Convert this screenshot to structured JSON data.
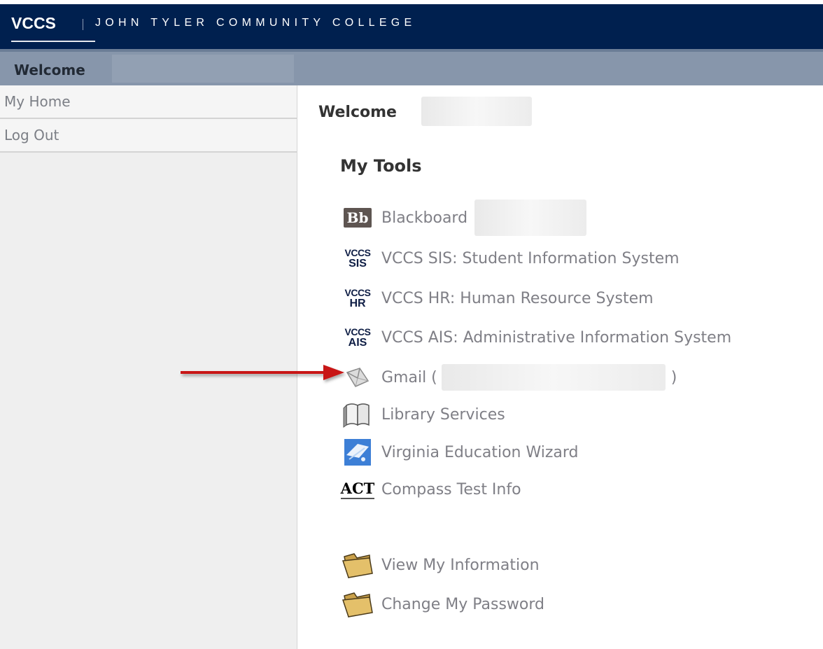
{
  "header": {
    "brand": "VCCS",
    "college": "JOHN TYLER COMMUNITY COLLEGE",
    "background": "#00204f"
  },
  "welcome_bar": {
    "title": "Welcome"
  },
  "sidebar": {
    "items": [
      {
        "label": "My Home"
      },
      {
        "label": "Log Out"
      }
    ]
  },
  "main": {
    "title": "Welcome",
    "tools_title": "My Tools",
    "tools": [
      {
        "label": "Blackboard",
        "icon": "blackboard-icon"
      },
      {
        "label": "VCCS SIS: Student Information System",
        "icon": "vccs-sis-icon",
        "icon_top": "VCCS",
        "icon_bottom": "SIS"
      },
      {
        "label": "VCCS HR: Human Resource System",
        "icon": "vccs-hr-icon",
        "icon_top": "VCCS",
        "icon_bottom": "HR"
      },
      {
        "label": "VCCS AIS: Administrative Information System",
        "icon": "vccs-ais-icon",
        "icon_top": "VCCS",
        "icon_bottom": "AIS"
      },
      {
        "label": "Gmail (",
        "label_tail": ")",
        "icon": "envelope-icon"
      },
      {
        "label": "Library Services",
        "icon": "book-icon"
      },
      {
        "label": "Virginia Education Wizard",
        "icon": "wizard-icon"
      },
      {
        "label": "Compass Test Info",
        "icon": "act-icon",
        "icon_text": "ACT"
      },
      {
        "label": "View My Information",
        "icon": "folder-icon"
      },
      {
        "label": "Change My Password",
        "icon": "folder-icon"
      }
    ],
    "bb_icon_text": "Bb"
  },
  "colors": {
    "link_gray": "#7f7f86",
    "welcome_bar": "#8796ab",
    "sidebar_bg": "#efefef",
    "arrow_red": "#c81414"
  }
}
